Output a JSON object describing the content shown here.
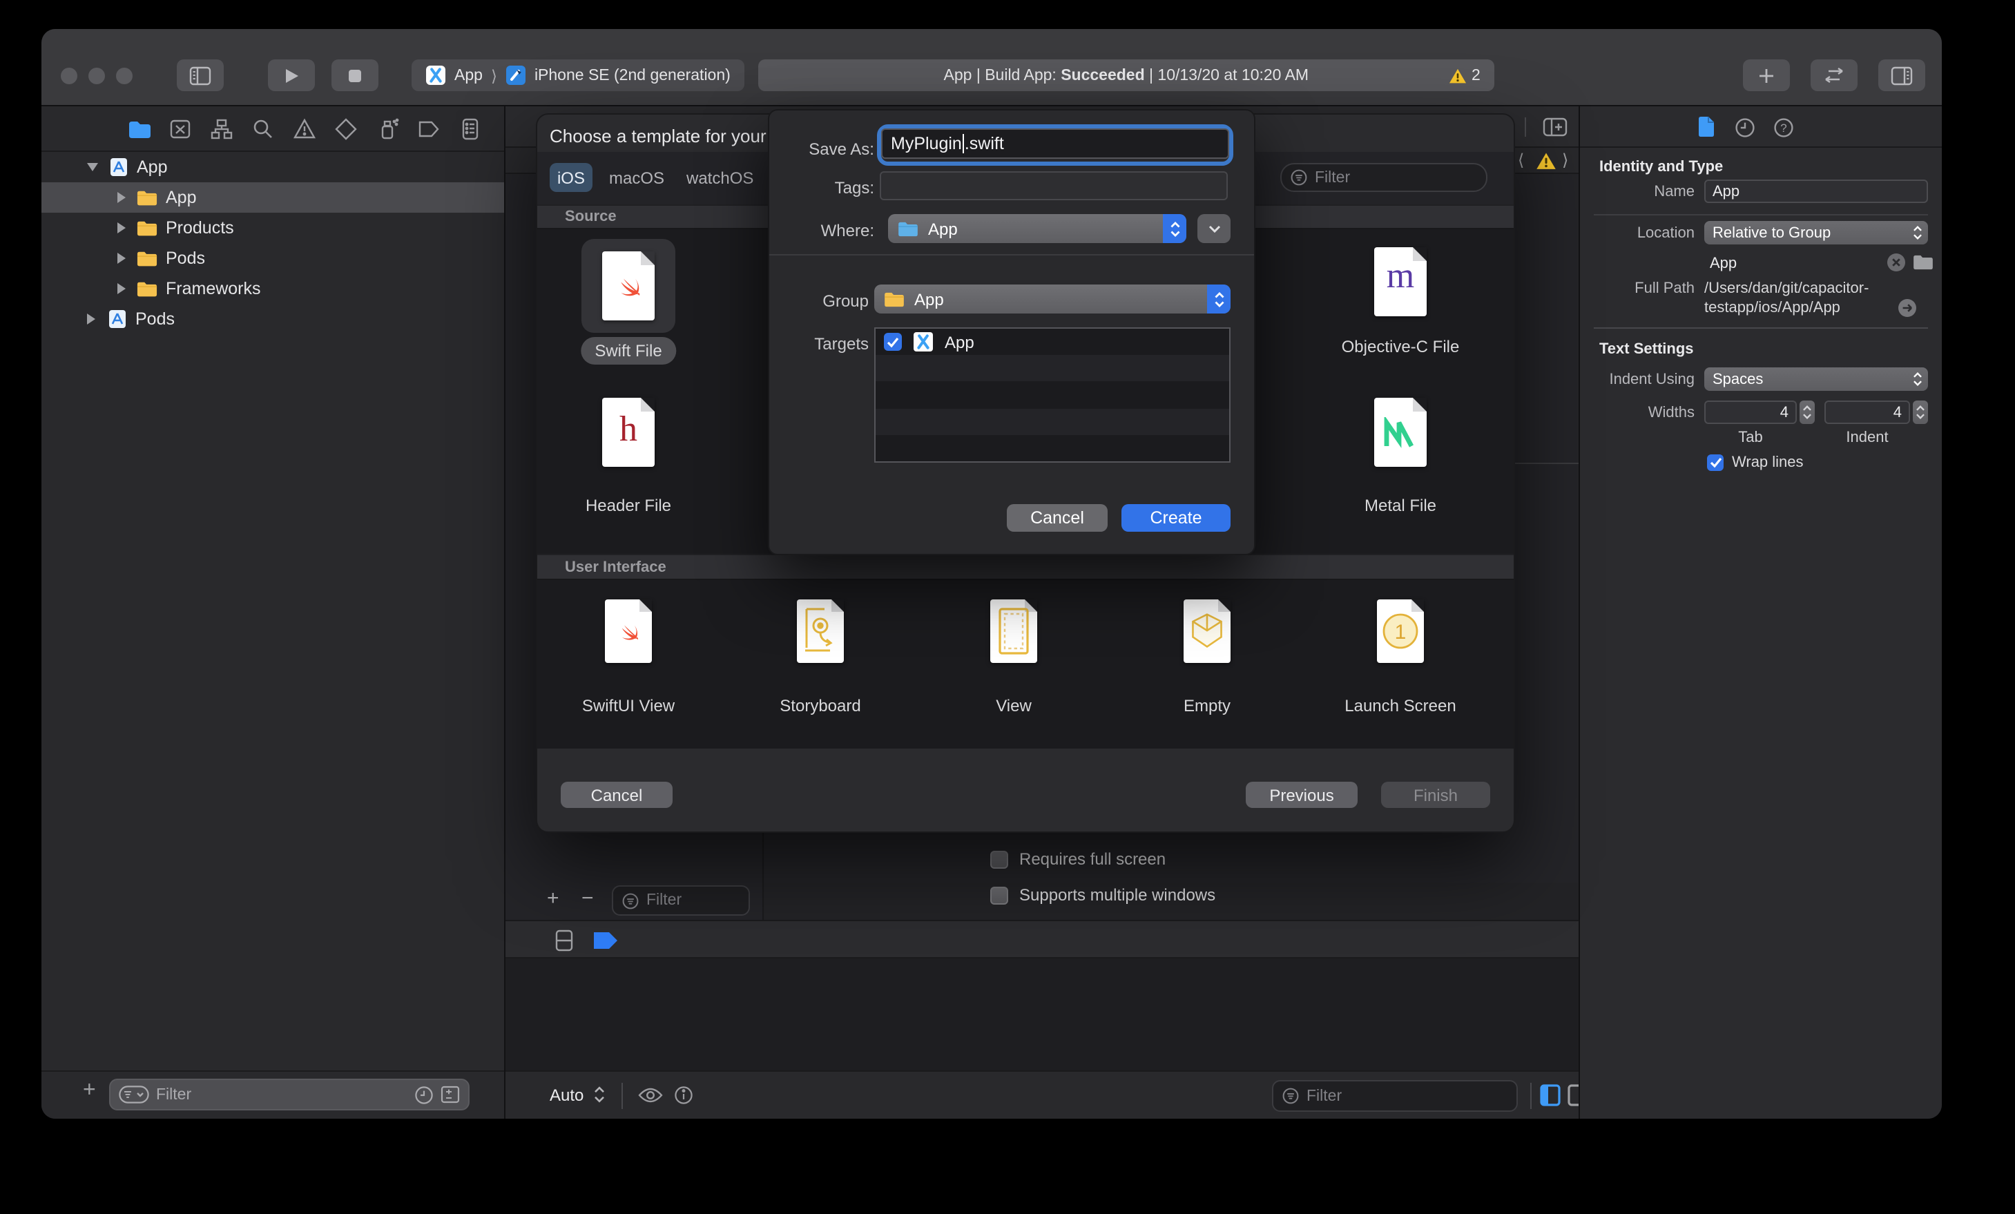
{
  "toolbar": {
    "scheme_target": "App",
    "scheme_sep": "⟩",
    "scheme_destination": "iPhone SE (2nd generation)",
    "status_prefix": "App | Build App: ",
    "status_bold": "Succeeded",
    "status_suffix": " | 10/13/20 at 10:20 AM",
    "warning_count": "2"
  },
  "navigator": {
    "tree": [
      {
        "label": "App",
        "type": "project",
        "expanded": true
      },
      {
        "label": "App",
        "type": "folder",
        "selected": true
      },
      {
        "label": "Products",
        "type": "folder"
      },
      {
        "label": "Pods",
        "type": "folder"
      },
      {
        "label": "Frameworks",
        "type": "folder"
      },
      {
        "label": "Pods",
        "type": "project"
      }
    ],
    "filter_placeholder": "Filter"
  },
  "template_dialog": {
    "title": "Choose a template for your",
    "tabs": [
      {
        "label": "iOS",
        "selected": true
      },
      {
        "label": "macOS"
      },
      {
        "label": "watchOS"
      }
    ],
    "filter_placeholder": "Filter",
    "source_title": "Source",
    "source_items": [
      {
        "label": "Swift File",
        "selected": true
      },
      {
        "label": "Header File"
      },
      {
        "label": "Objective-C File"
      },
      {
        "label": "Metal File"
      }
    ],
    "ui_title": "User Interface",
    "ui_items": [
      {
        "label": "SwiftUI View"
      },
      {
        "label": "Storyboard"
      },
      {
        "label": "View"
      },
      {
        "label": "Empty"
      },
      {
        "label": "Launch Screen"
      }
    ],
    "cancel_label": "Cancel",
    "previous_label": "Previous",
    "finish_label": "Finish"
  },
  "save_sheet": {
    "save_as_label": "Save As:",
    "filename_head": "MyPlugin",
    "filename_tail": ".swift",
    "tags_label": "Tags:",
    "where_label": "Where:",
    "where_value": "App",
    "group_label": "Group",
    "group_value": "App",
    "targets_label": "Targets",
    "target_name": "App",
    "target_checked": true,
    "cancel_label": "Cancel",
    "create_label": "Create"
  },
  "editor": {
    "requires_full_screen": "Requires full screen",
    "supports_multiple_windows": "Supports multiple windows",
    "pane_filter_placeholder": "Filter",
    "auto_label": "Auto",
    "bottom_filter_placeholder": "Filter"
  },
  "inspector": {
    "identity_title": "Identity and Type",
    "name_label": "Name",
    "name_value": "App",
    "location_label": "Location",
    "location_value": "Relative to Group",
    "location_file": "App",
    "full_path_label": "Full Path",
    "full_path_line1": "/Users/dan/git/capacitor-",
    "full_path_line2": "testapp/ios/App/App",
    "text_settings_title": "Text Settings",
    "indent_using_label": "Indent Using",
    "indent_using_value": "Spaces",
    "widths_label": "Widths",
    "tab_width": "4",
    "tab_caption": "Tab",
    "indent_width": "4",
    "indent_caption": "Indent",
    "wrap_lines_label": "Wrap lines",
    "wrap_lines_checked": true
  },
  "colors": {
    "accent_blue": "#3273e8",
    "focus_ring": "#3d79c9",
    "warning_yellow": "#f7c62c",
    "swift_orange": "#f05138",
    "objc_purple": "#5a3ba5",
    "header_red": "#a6232e",
    "metal_green": "#31d08f",
    "folder_yellow": "#f5c14e",
    "folder_blue": "#5fb1e8",
    "selected_tab": "#3a5068"
  }
}
